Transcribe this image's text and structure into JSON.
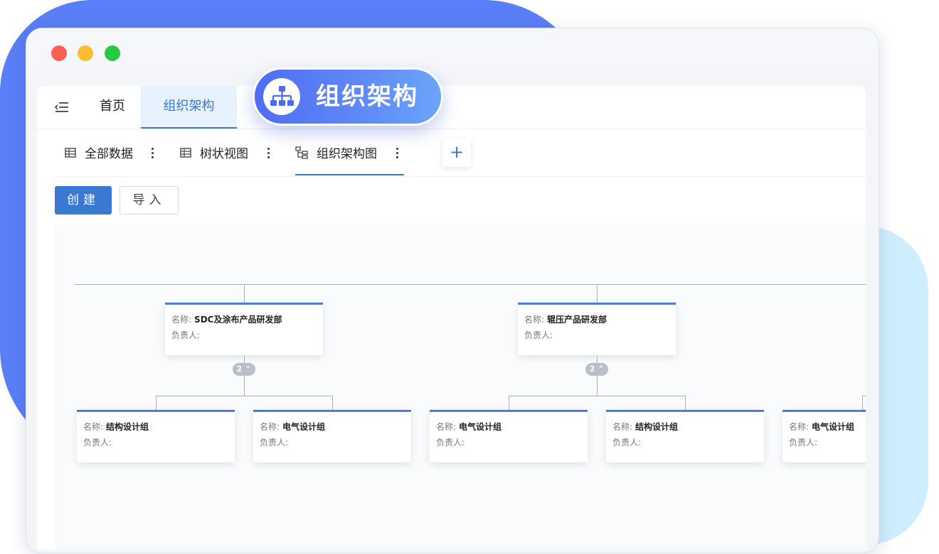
{
  "window": {
    "traffic_lights": [
      "close",
      "minimize",
      "maximize"
    ]
  },
  "tabs": {
    "home": "首页",
    "active": "组织架构"
  },
  "banner": {
    "label": "组织架构",
    "icon": "org-chart-icon"
  },
  "view_tabs": [
    {
      "label": "全部数据",
      "icon": "table-icon"
    },
    {
      "label": "树状视图",
      "icon": "table-icon"
    },
    {
      "label": "组织架构图",
      "icon": "org-tree-icon"
    }
  ],
  "add_view": "+",
  "actions": {
    "create": "创建",
    "import": "导入"
  },
  "org": {
    "name_label": "名称:",
    "owner_label": "负责人:",
    "level1": [
      {
        "name": "SDC及涂布产品研发部",
        "owner": "",
        "children_count": "2"
      },
      {
        "name": "辊压产品研发部",
        "owner": "",
        "children_count": "2"
      }
    ],
    "level2": [
      {
        "name": "结构设计组",
        "owner": ""
      },
      {
        "name": "电气设计组",
        "owner": ""
      },
      {
        "name": "电气设计组",
        "owner": ""
      },
      {
        "name": "结构设计组",
        "owner": ""
      },
      {
        "name": "电气设计组",
        "owner": ""
      }
    ]
  },
  "colors": {
    "accent": "#3a78d4",
    "blob_left": "#5a7df8",
    "blob_right": "#cfeefd"
  }
}
